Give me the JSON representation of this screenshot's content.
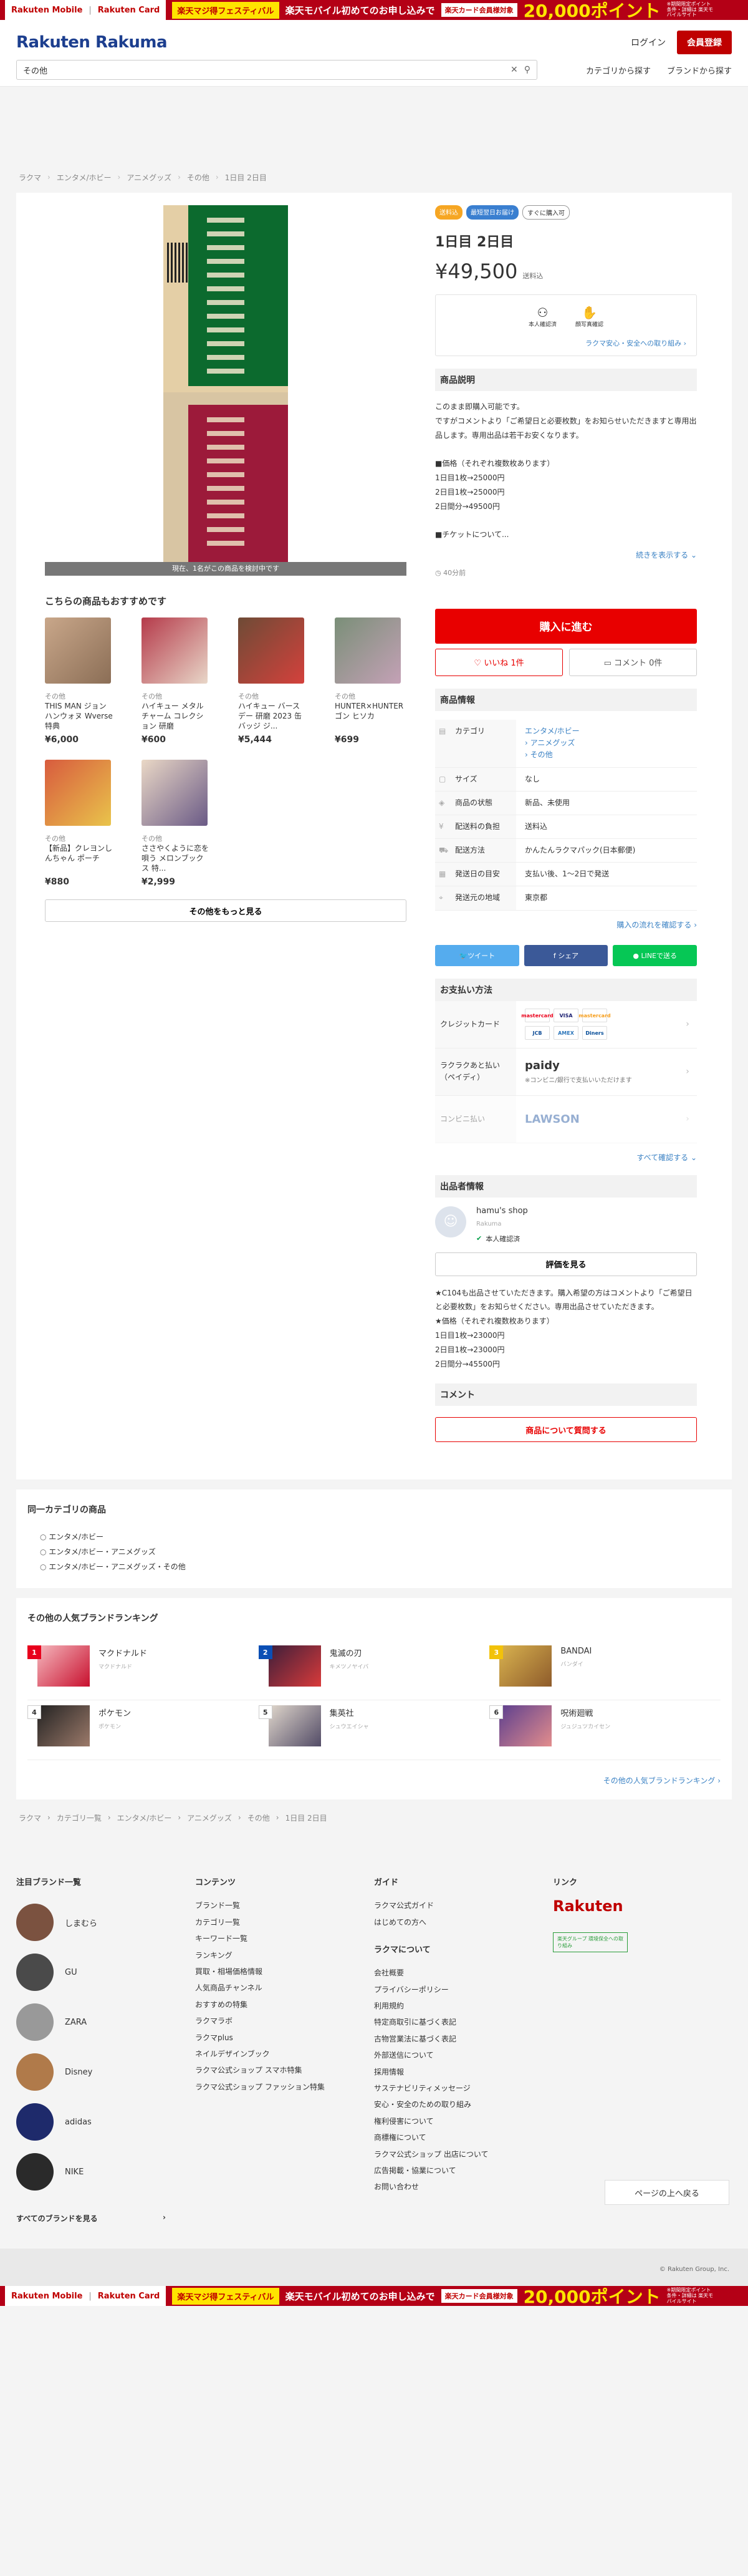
{
  "banner": {
    "mobile": "Rakuten Mobile",
    "card": "Rakuten Card",
    "festival": "楽天マジ得フェスティバル",
    "text": "楽天モバイル初めてのお申し込みで",
    "card_target": "楽天カード会員様対象",
    "points": "20,000ポイント",
    "note": "※期間限定ポイント 条件・詳細は 楽天モバイルサイト"
  },
  "header": {
    "logo": "Rakuten Rakuma",
    "login": "ログイン",
    "signup": "会員登録",
    "search_value": "その他",
    "nav_category": "カテゴリから探す",
    "nav_brand": "ブランドから探す"
  },
  "breadcrumb": [
    "ラクマ",
    "エンタメ/ホビー",
    "アニメグッズ",
    "その他",
    "1日目 2日目"
  ],
  "photo": {
    "watch_text": "現在、1名がこの商品を検討中です"
  },
  "recommend": {
    "title": "こちらの商品もおすすめです",
    "items": [
      {
        "cat": "その他",
        "name": "THIS MAN ジョンハンウォヌ Wverse特典",
        "price": "¥6,000"
      },
      {
        "cat": "その他",
        "name": "ハイキュー メタルチャーム コレクション 研磨",
        "price": "¥600"
      },
      {
        "cat": "その他",
        "name": "ハイキュー バースデー 研磨 2023 缶バッジ ジ...",
        "price": "¥5,444"
      },
      {
        "cat": "その他",
        "name": "HUNTER×HUNTER69 ゴン ヒソカ",
        "price": "¥699"
      },
      {
        "cat": "その他",
        "name": "【新品】クレヨンしんちゃん ポーチ",
        "price": "¥880"
      },
      {
        "cat": "その他",
        "name": "ささやくように恋を唄う メロンブックス 特...",
        "price": "¥2,999"
      }
    ],
    "more": "その他をもっと見る"
  },
  "item": {
    "tags": [
      "送料込",
      "最短翌日お届け",
      "すぐに購入可"
    ],
    "title": "1日目 2日目",
    "price": "¥49,500",
    "shipping": "送料込",
    "verify_1": "本人確認済",
    "verify_2": "顔写真確認",
    "verify_link": "ラクマ安心・安全への取り組み",
    "desc_head": "商品説明",
    "description": "このまま即購入可能です。\nですがコメントより「ご希望日と必要枚数」をお知らせいただきますと専用出品します。専用出品は若干お安くなります。\n\n■価格（それぞれ複数枚あります）\n1日目1枚→25000円\n2日目1枚→25000円\n2日間分→49500円\n\n■チケットについて...",
    "desc_more": "続きを表示する",
    "posted": "40分前",
    "buy": "購入に進む",
    "like": "いいね 1件",
    "comment": "コメント 0件"
  },
  "info": {
    "head": "商品情報",
    "rows": [
      {
        "k": "カテゴリ",
        "v": "エンタメ/ホビー\n› アニメグッズ\n› その他"
      },
      {
        "k": "サイズ",
        "v": "なし"
      },
      {
        "k": "商品の状態",
        "v": "新品、未使用"
      },
      {
        "k": "配送料の負担",
        "v": "送料込"
      },
      {
        "k": "配送方法",
        "v": "かんたんラクマパック(日本郵便)"
      },
      {
        "k": "発送日の目安",
        "v": "支払い後、1〜2日で発送"
      },
      {
        "k": "発送元の地域",
        "v": "東京都"
      }
    ],
    "flow_link": "購入の流れを確認する"
  },
  "share": {
    "twitter": "ツイート",
    "facebook": "シェア",
    "line": "LINEで送る"
  },
  "payment": {
    "head": "お支払い方法",
    "credit": "クレジットカード",
    "atobarai": "ラクラクあと払い（ペイディ）",
    "paidy": "paidy",
    "paidy_note": "※コンビニ/銀行で支払いいただけます",
    "conbini": "コンビニ払い",
    "lawson": "LAWSON",
    "see_all": "すべて確認する",
    "cards": [
      "mastercard",
      "VISA",
      "mastercard",
      "JCB",
      "AMEX",
      "Diners"
    ]
  },
  "seller": {
    "head": "出品者情報",
    "name": "hamu's shop",
    "sub": "Rakuma",
    "verified": "本人確認済",
    "eval": "評価を見る",
    "desc": "★C104も出品させていただきます。購入希望の方はコメントより「ご希望日と必要枚数」をお知らせください。専用出品させていただきます。\n★価格（それぞれ複数枚あります）\n1日目1枚→23000円\n2日目1枚→23000円\n2日間分→45500円"
  },
  "comment": {
    "head": "コメント",
    "ask": "商品について質問する"
  },
  "same_cat": {
    "title": "同一カテゴリの商品",
    "items": [
      "エンタメ/ホビー",
      "エンタメ/ホビー・アニメグッズ",
      "エンタメ/ホビー・アニメグッズ・その他"
    ]
  },
  "ranking": {
    "title": "その他の人気ブランドランキング",
    "items": [
      {
        "rank": "1",
        "name": "マクドナルド",
        "kana": "マクドナルド"
      },
      {
        "rank": "2",
        "name": "鬼滅の刃",
        "kana": "キメツノヤイバ"
      },
      {
        "rank": "3",
        "name": "BANDAI",
        "kana": "バンダイ"
      },
      {
        "rank": "4",
        "name": "ポケモン",
        "kana": "ポケモン"
      },
      {
        "rank": "5",
        "name": "集英社",
        "kana": "シュウエイシャ"
      },
      {
        "rank": "6",
        "name": "呪術廻戦",
        "kana": "ジュジュツカイセン"
      }
    ],
    "more": "その他の人気ブランドランキング"
  },
  "bottom_breadcrumb": [
    "ラクマ",
    "カテゴリ一覧",
    "エンタメ/ホビー",
    "アニメグッズ",
    "その他",
    "1日目 2日目"
  ],
  "footer": {
    "brands_head": "注目ブランド一覧",
    "brands": [
      "しまむら",
      "GU",
      "ZARA",
      "Disney",
      "adidas",
      "NIKE"
    ],
    "all_brands": "すべてのブランドを見る",
    "contents_head": "コンテンツ",
    "contents": [
      "ブランド一覧",
      "カテゴリ一覧",
      "キーワード一覧",
      "ランキング",
      "買取・相場価格情報",
      "人気商品チャンネル",
      "おすすめの特集",
      "ラクマラボ",
      "ラクマplus",
      "ネイルデザインブック",
      "ラクマ公式ショップ スマホ特集",
      "ラクマ公式ショップ ファッション特集"
    ],
    "guide_head": "ガイド",
    "guide": [
      "ラクマ公式ガイド",
      "はじめての方へ"
    ],
    "about_head": "ラクマについて",
    "about": [
      "会社概要",
      "プライバシーポリシー",
      "利用規約",
      "特定商取引に基づく表記",
      "古物営業法に基づく表記",
      "外部送信について",
      "採用情報",
      "サステナビリティメッセージ",
      "安心・安全のための取り組み",
      "権利侵害について",
      "商標権について",
      "ラクマ公式ショップ 出店について",
      "広告掲載・協業について",
      "お問い合わせ"
    ],
    "links_head": "リンク",
    "rakuten": "Rakuten",
    "green": "楽天グループ 環境保全への取り組み",
    "top_btn": "ページの上へ戻る",
    "copyright": "© Rakuten Group, Inc."
  }
}
